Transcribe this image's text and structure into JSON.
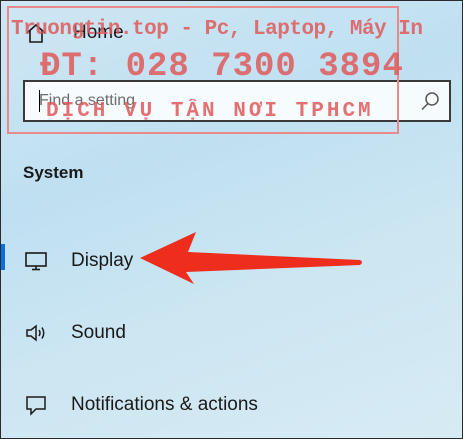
{
  "nav": {
    "home_label": "Home",
    "search_placeholder": "Find a setting",
    "section_title": "System",
    "items": [
      {
        "label": "Display"
      },
      {
        "label": "Sound"
      },
      {
        "label": "Notifications & actions"
      }
    ]
  },
  "watermark": {
    "line1": "Truongtin.top - Pc, Laptop, Máy In",
    "line2": "ĐT: 028 7300 3894",
    "line3": "DỊCH VỤ TẬN NƠI TPHCM"
  },
  "colors": {
    "accent": "#0a6fd6",
    "annotation_arrow": "#ee2d1d",
    "watermark": "#e05a5a"
  }
}
